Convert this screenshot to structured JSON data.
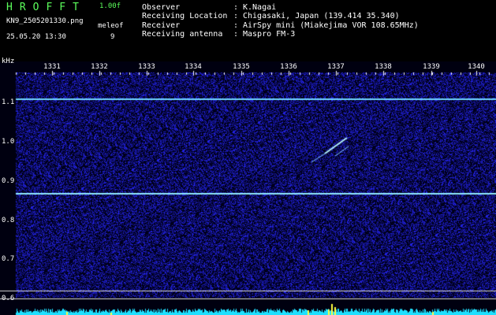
{
  "header": {
    "logo": "HROFFT",
    "version": "1.00f",
    "filename": "KN9_2505201330.png",
    "datetime": "25.05.20 13:30",
    "mode_label": "meleof",
    "mode_value": "9"
  },
  "meta": {
    "observer_label": "Observer",
    "observer": "K.Nagai",
    "location_label": "Receiving Location",
    "location": "Chigasaki, Japan (139.414 35.340)",
    "receiver_label": "Receiver",
    "receiver": "AirSpy mini (Miakejima VOR 108.65MHz)",
    "antenna_label": "Receiving antenna",
    "antenna": "Maspro FM-3",
    "colon": ":"
  },
  "axes": {
    "y_unit": "kHz",
    "x_ticks": [
      "1331",
      "1332",
      "1333",
      "1334",
      "1335",
      "1336",
      "1337",
      "1338",
      "1339",
      "1340"
    ],
    "y_ticks": [
      "1.1",
      "1.0",
      "0.9",
      "0.8",
      "0.7",
      "0.6"
    ]
  },
  "colors": {
    "background": "#000000",
    "noise_blue": "#1a1aff",
    "trace_line": "#6fd4ff",
    "spectrum": "#1ee0ff",
    "spike": "#ffff40",
    "header_green": "#5cff5c"
  }
}
